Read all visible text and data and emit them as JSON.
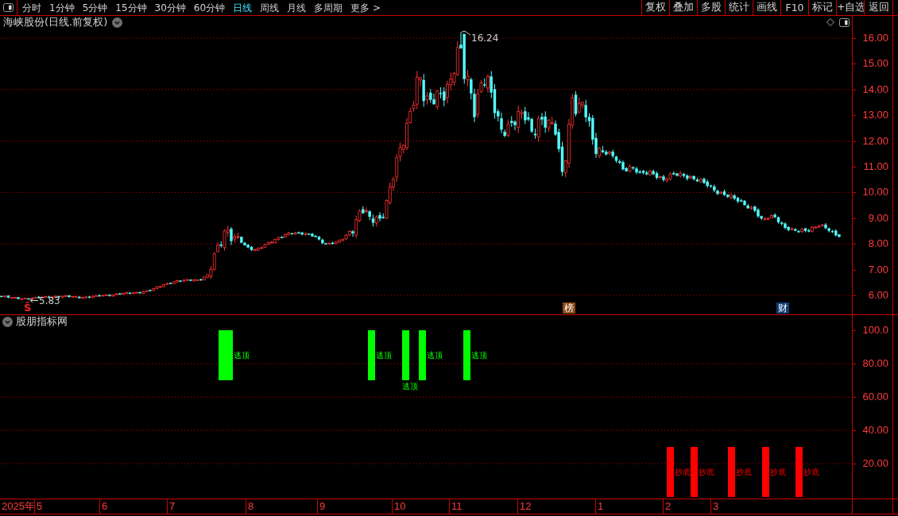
{
  "toolbar": {
    "periods": [
      {
        "label": "分时",
        "selected": false
      },
      {
        "label": "1分钟",
        "selected": false
      },
      {
        "label": "5分钟",
        "selected": false
      },
      {
        "label": "15分钟",
        "selected": false
      },
      {
        "label": "30分钟",
        "selected": false
      },
      {
        "label": "60分钟",
        "selected": false
      },
      {
        "label": "日线",
        "selected": true
      },
      {
        "label": "周线",
        "selected": false
      },
      {
        "label": "月线",
        "selected": false
      },
      {
        "label": "多周期",
        "selected": false
      },
      {
        "label": "更多 >",
        "selected": false
      }
    ],
    "actions": [
      "复权",
      "叠加",
      "多股",
      "统计",
      "画线",
      "F10",
      "标记",
      "+自选",
      "返回"
    ]
  },
  "price_pane": {
    "title": "海峡股份(日线.前复权)",
    "y_ticks": [
      "16.00",
      "15.00",
      "14.00",
      "13.00",
      "12.00",
      "11.00",
      "10.00",
      "9.00",
      "8.00",
      "7.00",
      "6.00"
    ],
    "high_label": "16.24",
    "low_label": "5.83",
    "markers": [
      {
        "kind": "signal",
        "label": "Ŝ"
      },
      {
        "kind": "list",
        "label": "榜"
      },
      {
        "kind": "finance",
        "label": "财"
      }
    ]
  },
  "indicator_pane": {
    "title": "股朋指标网",
    "y_ticks": [
      "100.0",
      "80.00",
      "60.00",
      "40.00",
      "20.00"
    ],
    "signals": [
      {
        "kind": "top",
        "label": "逃顶"
      },
      {
        "kind": "top",
        "label": "逃顶"
      },
      {
        "kind": "top",
        "label": "逃顶"
      },
      {
        "kind": "top",
        "label": "逃顶"
      },
      {
        "kind": "top",
        "label": "逃顶"
      },
      {
        "kind": "bottom",
        "label": "抄底"
      },
      {
        "kind": "bottom",
        "label": "抄底"
      },
      {
        "kind": "bottom",
        "label": "抄底"
      },
      {
        "kind": "bottom",
        "label": "抄底"
      },
      {
        "kind": "bottom",
        "label": "抄底"
      }
    ]
  },
  "time_axis": {
    "year": "2025年",
    "months": [
      "5",
      "6",
      "7",
      "8",
      "9",
      "10",
      "11",
      "12",
      "1",
      "2",
      "3"
    ]
  }
}
